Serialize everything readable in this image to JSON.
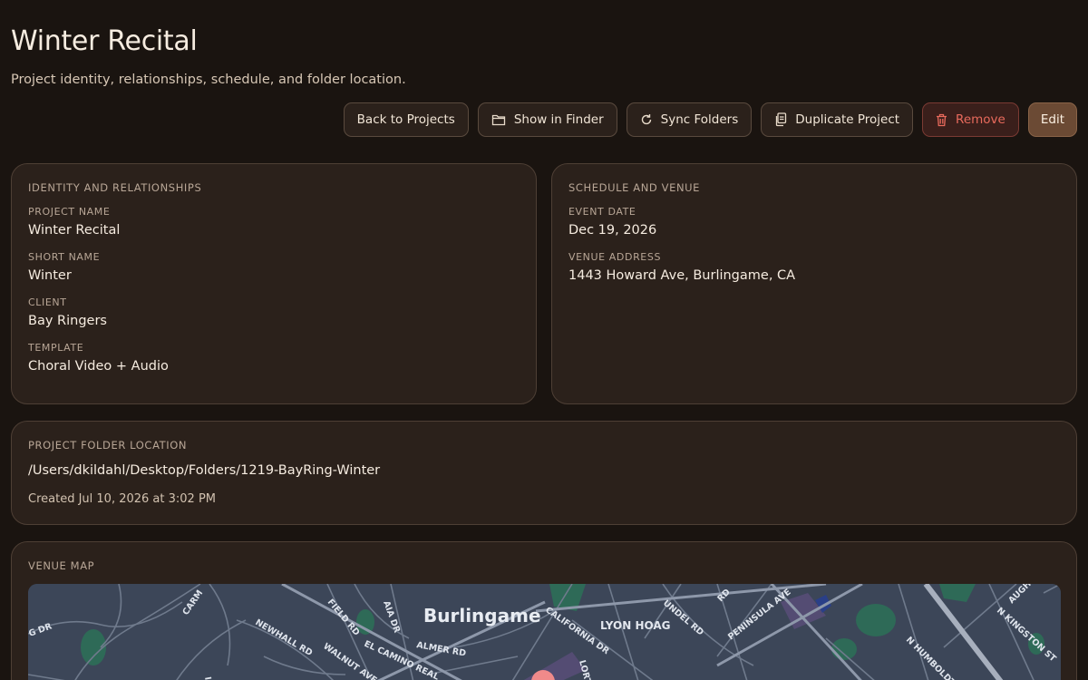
{
  "header": {
    "title": "Winter Recital",
    "subtitle": "Project identity, relationships, schedule, and folder location."
  },
  "actions": {
    "back": "Back to Projects",
    "finder": "Show in Finder",
    "sync": "Sync Folders",
    "duplicate": "Duplicate Project",
    "remove": "Remove",
    "edit": "Edit"
  },
  "identity": {
    "heading": "IDENTITY AND RELATIONSHIPS",
    "project_name_label": "PROJECT NAME",
    "project_name": "Winter Recital",
    "short_name_label": "SHORT NAME",
    "short_name": "Winter",
    "client_label": "CLIENT",
    "client": "Bay Ringers",
    "template_label": "TEMPLATE",
    "template": "Choral Video + Audio"
  },
  "schedule": {
    "heading": "SCHEDULE AND VENUE",
    "event_date_label": "EVENT DATE",
    "event_date": "Dec 19, 2026",
    "venue_address_label": "VENUE ADDRESS",
    "venue_address": "1443 Howard Ave, Burlingame, CA"
  },
  "folder": {
    "heading": "PROJECT FOLDER LOCATION",
    "path": "/Users/dkildahl/Desktop/Folders/1219-BayRing-Winter",
    "created": "Created Jul 10, 2026 at 3:02 PM"
  },
  "map": {
    "heading": "VENUE MAP",
    "city_label": "Burlingame",
    "poi_label": "LYON HOAG",
    "streets": {
      "carmelita": "CARM",
      "field": "FIELD RD",
      "pepper": "AIA DR",
      "newhall": "NEWHALL RD",
      "walnut": "WALNUT AVE",
      "elcamino": "EL CAMINO REAL",
      "almer": "ALMER RD",
      "california": "CALIFORNIA DR",
      "lorton": "LORTON",
      "lundel": "UNDEL RD",
      "rd": "RD",
      "peninsula": "PENINSULA AVE",
      "humboldt": "N HUMBOLDT ST",
      "kingston": "N KINGSTON ST",
      "claremont": "AUGH ST",
      "dr": "G DR",
      "ir": "IR"
    },
    "colors": {
      "land": "#3c4658",
      "road": "#7d8799",
      "park": "#2e6a57",
      "pin": "#f08a8a"
    }
  }
}
